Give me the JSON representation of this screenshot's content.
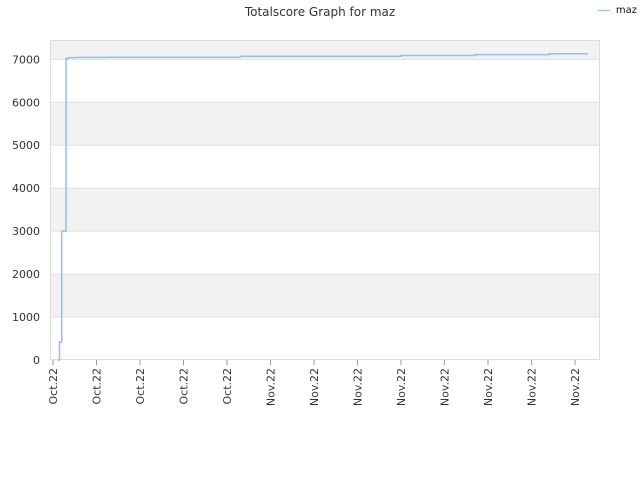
{
  "chart_data": {
    "type": "line",
    "title": "Totalscore Graph for maz",
    "xlabel": "",
    "ylabel": "",
    "ylim": [
      0,
      7450
    ],
    "yticks": [
      0,
      1000,
      2000,
      3000,
      4000,
      5000,
      6000,
      7000
    ],
    "x_tick_labels": [
      "Oct.22",
      "Oct.22",
      "Oct.22",
      "Oct.22",
      "Oct.22",
      "Nov.22",
      "Nov.22",
      "Nov.22",
      "Nov.22",
      "Nov.22",
      "Nov.22",
      "Nov.22",
      "Nov.22"
    ],
    "grid": true,
    "legend_position": "top-right",
    "colors": {
      "series": "#90c0f0",
      "band": "#f2f2f2",
      "grid": "#e0e0e0"
    },
    "series": [
      {
        "name": "maz",
        "x": [
          0.1,
          0.15,
          0.15,
          0.2,
          0.2,
          0.3,
          0.3,
          0.35,
          0.35,
          0.55,
          0.6,
          1.3,
          1.3,
          4.3,
          4.3,
          8.0,
          8.0,
          9.7,
          9.7,
          11.4,
          11.4,
          12.3
        ],
        "y": [
          0,
          0,
          420,
          420,
          3000,
          3000,
          7020,
          7020,
          7040,
          7040,
          7045,
          7045,
          7050,
          7050,
          7070,
          7070,
          7090,
          7090,
          7110,
          7110,
          7130,
          7130
        ]
      }
    ]
  }
}
